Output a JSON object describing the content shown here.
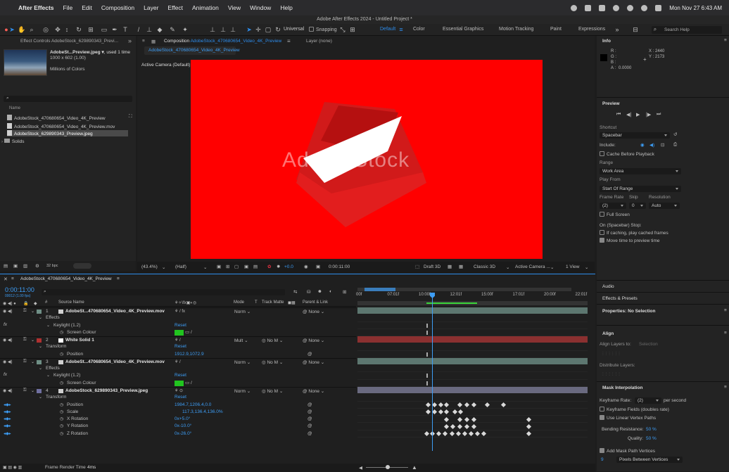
{
  "menubar": {
    "app": "After Effects",
    "items": [
      "File",
      "Edit",
      "Composition",
      "Layer",
      "Effect",
      "Animation",
      "View",
      "Window",
      "Help"
    ],
    "datetime": "Mon Nov 27  6:43 AM"
  },
  "window_title": "Adobe After Effects 2024 - Untitled Project *",
  "toolbar": {
    "universal": "Universal",
    "snapping": "Snapping",
    "workspaces": [
      "Default",
      "Color",
      "Essential Graphics",
      "Motion Tracking",
      "Paint",
      "Expressions"
    ],
    "search_placeholder": "Search Help"
  },
  "project": {
    "tab_effects": "Effect Controls AdobeStock_629890343_Previ...",
    "thumb_name": "AdobeSt...Preview.jpeg",
    "thumb_used": ", used 1 time",
    "thumb_dims": "1000 x 602 (1.00)",
    "thumb_colors": "Millions of Colors",
    "col_name": "Name",
    "items": [
      "AdobeStock_470680654_Video_4K_Preview",
      "AdobeStock_470680654_Video_4K_Preview.mov",
      "AdobeStock_629890343_Preview.jpeg",
      "Solids"
    ],
    "bpc": "32 bpc"
  },
  "composition": {
    "tab_prefix": "Composition",
    "tab_name": "AdobeStock_470680654_Video_4K_Preview",
    "layer_tab": "Layer (none)",
    "subtab": "AdobeStock_470680654_Video_4K_Preview",
    "camera": "Active Camera (Default)",
    "watermark": "Adobe Stock",
    "zoom": "(43.4%)",
    "res": "(Half)",
    "exposure": "+0.0",
    "timecode": "0:00:11:00",
    "draft": "Draft 3D",
    "renderer": "Classic 3D",
    "cam_dd": "Active Camera ...",
    "views": "1 View"
  },
  "info": {
    "title": "Info",
    "r": "R :",
    "g": "G :",
    "b": "B :",
    "a": "A :",
    "a_val": "0.0000",
    "x": "X : 2440",
    "y": "Y : 2173"
  },
  "preview": {
    "title": "Preview",
    "shortcut_lbl": "Shortcut",
    "shortcut": "Spacebar",
    "include": "Include:",
    "cache": "Cache Before Playback",
    "range_lbl": "Range",
    "range": "Work Area",
    "play_from_lbl": "Play From",
    "play_from": "Start Of Range",
    "fr_lbl": "Frame Rate",
    "skip_lbl": "Skip",
    "res_lbl": "Resolution",
    "fr": "(2)",
    "skip": "0",
    "res": "Auto",
    "fullscreen": "Full Screen",
    "on_stop": "On (Spacebar) Stop:",
    "if_caching": "If caching, play cached frames",
    "move_time": "Move time to preview time"
  },
  "side": {
    "audio": "Audio",
    "effects_presets": "Effects & Presets",
    "properties": "Properties: No Selection",
    "align": "Align",
    "align_to": "Align Layers to:",
    "selection": "Selection",
    "distribute": "Distribute Layers:",
    "mask_title": "Mask Interpolation",
    "kf_rate_lbl": "Keyframe Rate:",
    "kf_rate": "(2)",
    "per_second": "per second",
    "kf_fields": "Keyframe Fields (doubles rate)",
    "linear": "Use Linear Vertex Paths",
    "bending_lbl": "Bending Resistance:",
    "bending": "50 %",
    "quality_lbl": "Quality:",
    "quality": "50 %",
    "add_mask": "Add Mask Path Vertices",
    "pixels_num": "9",
    "pixels": "Pixels Between Vertices"
  },
  "timeline": {
    "tab": "AdobeStock_470680654_Video_4K_Preview",
    "timecode": "0:00:11:00",
    "fps": "00012 (1.00 fps)",
    "col_hash": "#",
    "col_source": "Source Name",
    "col_mode": "Mode",
    "col_t": "T",
    "col_track": "Track Matte",
    "col_parent": "Parent & Link",
    "ruler": [
      "00f",
      "07:01f",
      "10:00f",
      "12:01f",
      "15:00f",
      "17:01f",
      "20:00f",
      "22:01f"
    ],
    "footer": "Frame Render Time",
    "render_time": "4ms",
    "rows": [
      {
        "num": "1",
        "name": "AdobeSt...470680654_Video_4K_Preview.mov",
        "mode": "Norm",
        "parent": "None"
      },
      {
        "name": "Effects"
      },
      {
        "name": "Keylight (1.2)",
        "value": "Reset"
      },
      {
        "name": "Screen Colour"
      },
      {
        "num": "2",
        "name": "White Solid 1",
        "mode": "Mult",
        "matte": "No M",
        "parent": "None"
      },
      {
        "name": "Transform",
        "value": "Reset"
      },
      {
        "name": "Position",
        "value": "1912.9,1072.9"
      },
      {
        "num": "3",
        "name": "AdobeSt...470680654_Video_4K_Preview.mov",
        "mode": "Norm",
        "matte": "No M",
        "parent": "None"
      },
      {
        "name": "Effects"
      },
      {
        "name": "Keylight (1.2)",
        "value": "Reset"
      },
      {
        "name": "Screen Colour"
      },
      {
        "num": "4",
        "name": "AdobeStock_629890343_Preview.jpeg",
        "mode": "Norm",
        "matte": "No M",
        "parent": "None"
      },
      {
        "name": "Transform",
        "value": "Reset"
      },
      {
        "name": "Position",
        "value": "1984.7,1206.4,0.0"
      },
      {
        "name": "Scale",
        "value": "117.3,136.4,136.0%"
      },
      {
        "name": "X Rotation",
        "value": "0x+5.0°"
      },
      {
        "name": "Y Rotation",
        "value": "0x-10.0°"
      },
      {
        "name": "Z Rotation",
        "value": "0x-26.0°"
      }
    ]
  },
  "colors": {
    "accent": "#2d8ceb",
    "comp_bg": "#ff0000",
    "layer_teal": "#5d7770",
    "layer_red": "#8b3030",
    "layer_blue": "#6a6a80"
  }
}
